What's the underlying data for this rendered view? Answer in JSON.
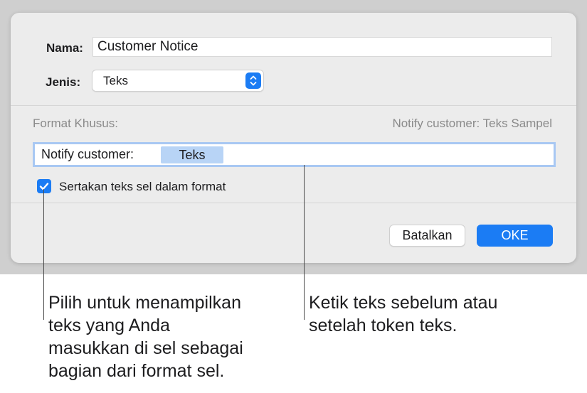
{
  "dialog": {
    "name_label": "Nama:",
    "name_value": "Customer Notice",
    "type_label": "Jenis:",
    "type_value": "Teks",
    "custom_format_label": "Format Khusus:",
    "sample_text": "Notify customer: Teks Sampel",
    "format_prefix": "Notify customer:",
    "token_label": "Teks",
    "checkbox_label": "Sertakan teks sel dalam format",
    "checkbox_checked": true,
    "cancel_label": "Batalkan",
    "ok_label": "OKE"
  },
  "callouts": {
    "left_line1": "Pilih untuk menampilkan",
    "left_line2": "teks yang Anda",
    "left_line3": "masukkan di sel sebagai",
    "left_line4": "bagian dari format sel.",
    "right_line1": "Ketik teks sebelum atau",
    "right_line2": "setelah token teks."
  },
  "colors": {
    "accent": "#1b7cf4",
    "token_background": "#b8d4f6",
    "focus_ring": "#a8c8f3"
  },
  "icons": {
    "select_arrows": "up-down-chevron-icon",
    "checkbox": "checkmark-icon"
  }
}
